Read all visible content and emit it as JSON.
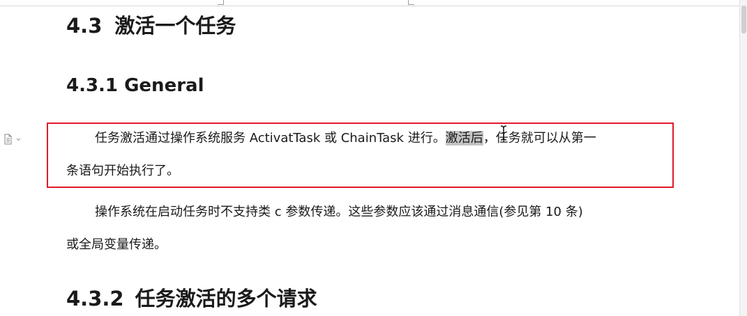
{
  "document": {
    "section_heading": {
      "number": "4.3",
      "title": "激活一个任务"
    },
    "subsection_general": {
      "text": "4.3.1 General"
    },
    "paragraph_1": {
      "line1_before": "任务激活通过操作系统服务 ActivatTask 或 ChainTask 进行。",
      "line1_selected": "激活后",
      "line1_after": "，任务就可以从第一",
      "line2": "条语句开始执行了。"
    },
    "paragraph_2": {
      "line1": "操作系统在启动任务时不支持类 c 参数传递。这些参数应该通过消息通信(参见第 10 条)",
      "line2": "或全局变量传递。"
    },
    "subsection_multiple": {
      "number": "4.3.2",
      "title": "任务激活的多个请求"
    }
  },
  "annotation": {
    "highlight_color": "#e01a2b",
    "selection_color": "#c4c4c4"
  },
  "icons": {
    "paragraph_marker": "document-icon",
    "mouse_cursor": "text-cursor-icon"
  }
}
